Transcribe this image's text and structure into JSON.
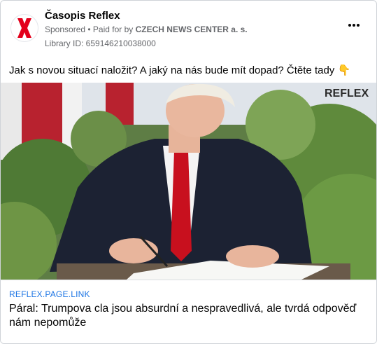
{
  "post": {
    "page_name": "Časopis Reflex",
    "sponsored_label": "Sponsored",
    "separator": " • ",
    "paid_for_prefix": "Paid for by ",
    "paid_for_by": "CZECH NEWS CENTER a. s.",
    "library_id": "Library ID: 659146210038000",
    "more_icon": "more-horizontal-icon",
    "message": "Jak s novou situací naložit? A jaký na nás bude mít dopad? Čtěte tady 👇"
  },
  "image": {
    "watermark": "REFLEX",
    "description_icon": "photo"
  },
  "link": {
    "domain": "REFLEX.PAGE.LINK",
    "headline": "Páral: Trumpova cla jsou absurdní a nespravedlivá, ale tvrdá odpověď nám nepomůže"
  },
  "colors": {
    "brand_red": "#e3001b",
    "link_blue": "#1b74e4",
    "secondary_text": "#65676b"
  }
}
